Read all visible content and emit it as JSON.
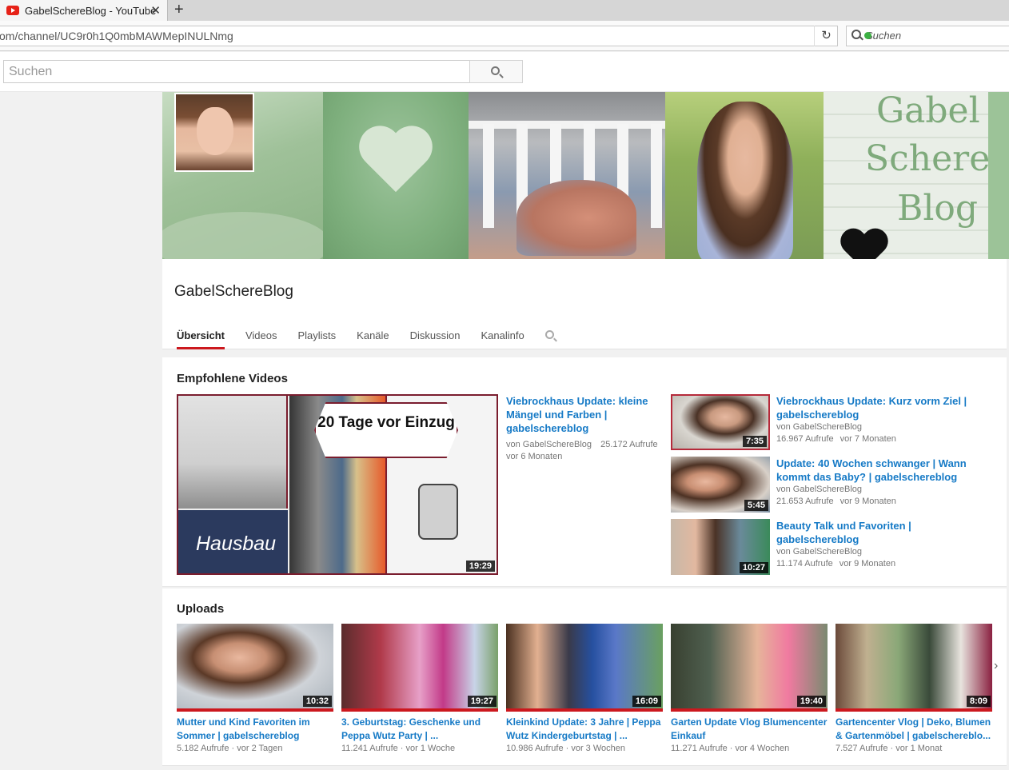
{
  "browser": {
    "tab_title": "GabelSchereBlog - YouTube",
    "tab_close": "✕",
    "new_tab": "+",
    "url": "om/channel/UC9r0h1Q0mbMAWMepINULNmg",
    "reload": "↻",
    "search_placeholder": "Suchen"
  },
  "masthead": {
    "search_placeholder": "Suchen"
  },
  "banner": {
    "words": [
      "Gabel",
      "Schere",
      "Blog"
    ]
  },
  "channel": {
    "name": "GabelSchereBlog",
    "tabs": [
      "Übersicht",
      "Videos",
      "Playlists",
      "Kanäle",
      "Diskussion",
      "Kanalinfo"
    ],
    "active_tab": "Übersicht"
  },
  "featured": {
    "heading": "Empfohlene Videos",
    "main": {
      "overlay_text": "20 Tage vor Einzug",
      "label": "Hausbau",
      "duration": "19:29",
      "title": "Viebrockhaus Update: kleine Mängel und Farben | gabelschereblog",
      "channel": "von GabelSchereBlog",
      "views": "25.172 Aufrufe",
      "age": "vor 6 Monaten"
    },
    "side": [
      {
        "title": "Viebrockhaus Update: Kurz vorm Ziel | gabelschereblog",
        "channel": "von GabelSchereBlog",
        "views": "16.967 Aufrufe",
        "age": "vor 7 Monaten",
        "duration": "7:35"
      },
      {
        "title": "Update: 40 Wochen schwanger | Wann kommt das Baby? | gabelschereblog",
        "channel": "von GabelSchereBlog",
        "views": "21.653 Aufrufe",
        "age": "vor 9 Monaten",
        "duration": "5:45"
      },
      {
        "title": "Beauty Talk und Favoriten | gabelschereblog",
        "channel": "von GabelSchereBlog",
        "views": "11.174 Aufrufe",
        "age": "vor 9 Monaten",
        "duration": "10:27"
      }
    ]
  },
  "uploads": {
    "heading": "Uploads",
    "items": [
      {
        "title": "Mutter und Kind Favoriten im Sommer | gabelschereblog",
        "views": "5.182 Aufrufe",
        "age": "vor 2 Tagen",
        "duration": "10:32"
      },
      {
        "title": "3. Geburtstag: Geschenke und Peppa Wutz Party | ...",
        "views": "11.241 Aufrufe",
        "age": "vor 1 Woche",
        "duration": "19:27"
      },
      {
        "title": "Kleinkind Update: 3 Jahre | Peppa Wutz Kindergeburtstag | ...",
        "views": "10.986 Aufrufe",
        "age": "vor 3 Wochen",
        "duration": "16:09"
      },
      {
        "title": "Garten Update Vlog Blumencenter Einkauf",
        "views": "11.271 Aufrufe",
        "age": "vor 4 Wochen",
        "duration": "19:40"
      },
      {
        "title": "Gartencenter Vlog | Deko, Blumen & Gartenmöbel | gabelschereblo...",
        "views": "7.527 Aufrufe",
        "age": "vor 1 Monat",
        "duration": "8:09"
      }
    ],
    "next_arrow": "›"
  },
  "colors": {
    "link": "#167ac6",
    "accent": "#cc181e",
    "meta": "#767676"
  }
}
